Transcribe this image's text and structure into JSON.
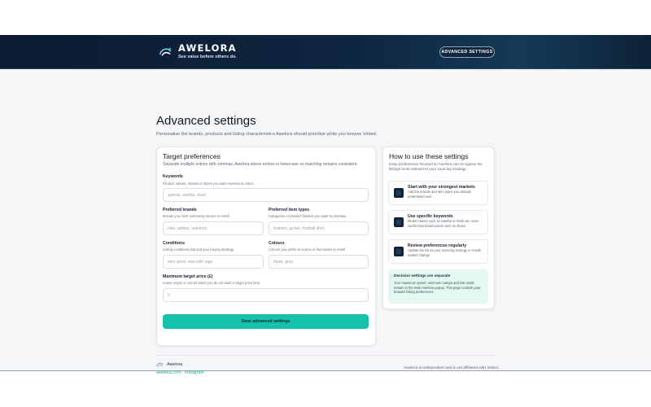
{
  "header": {
    "brand_name": "AWELORA",
    "tagline": "See value before others do.",
    "advanced_button": "ADVANCED SETTINGS"
  },
  "page": {
    "title": "Advanced settings",
    "subtitle": "Personalise the brands, products and listing characteristics Awelora should prioritise while you browse Vinted."
  },
  "target_preferences": {
    "title": "Target preferences",
    "description": "Separate multiple entries with commas. Awelora stores entries in lowercase so matching remains consistent.",
    "keywords": {
      "label": "Keywords",
      "hint": "Product names, models or styles you want Awelora to notice.",
      "placeholder": "special, samba, dunk"
    },
    "brands": {
      "label": "Preferred brands",
      "hint": "Brands you most commonly source or resell.",
      "placeholder": "nike, adidas, salomon"
    },
    "item_types": {
      "label": "Preferred item types",
      "hint": "Categories or product families you want to prioritise.",
      "placeholder": "trainers, jacket, football shirt"
    },
    "conditions": {
      "label": "Conditions",
      "hint": "Listing conditions that suit your buying strategy.",
      "placeholder": "very good, new with tags"
    },
    "colours": {
      "label": "Colours",
      "hint": "Colours you prefer to source or find easier to resell.",
      "placeholder": "black, grey"
    },
    "max_price": {
      "label": "Maximum target price (£)",
      "hint": "Leave empty or use £0 when you do not want a target price limit.",
      "placeholder": "0"
    },
    "save_button": "Save advanced settings"
  },
  "how_to": {
    "title": "How to use these settings",
    "description": "Keep preferences focused so Awelora can recognise the listings most relevant to your sourcing strategy.",
    "tips": [
      {
        "title": "Start with your strongest markets",
        "body": "Add the brands and item types you already understand well."
      },
      {
        "title": "Use specific keywords",
        "body": "Model names such as Samba or Dunk are more useful than broad words such as shoes"
      },
      {
        "title": "Review preferences regularly",
        "body": "Update the list as your sourcing strategy or resale market change."
      }
    ],
    "notice": {
      "title": "Decision settings are separate",
      "body": "Your maximum spend, minimum margin and risk mode remain in the main Awelora popup. This page controls your broader listing preferences."
    }
  },
  "footer": {
    "brand": "Awelora",
    "link_site": "awelora.com",
    "link_instagram": "Instagram",
    "disclaimer": "Awelora is independent and is not affiliated with Vinted."
  },
  "colors": {
    "accent": "#17c2ad",
    "header_bg": "#0c1a33",
    "notice_bg": "#e4f7f1"
  }
}
